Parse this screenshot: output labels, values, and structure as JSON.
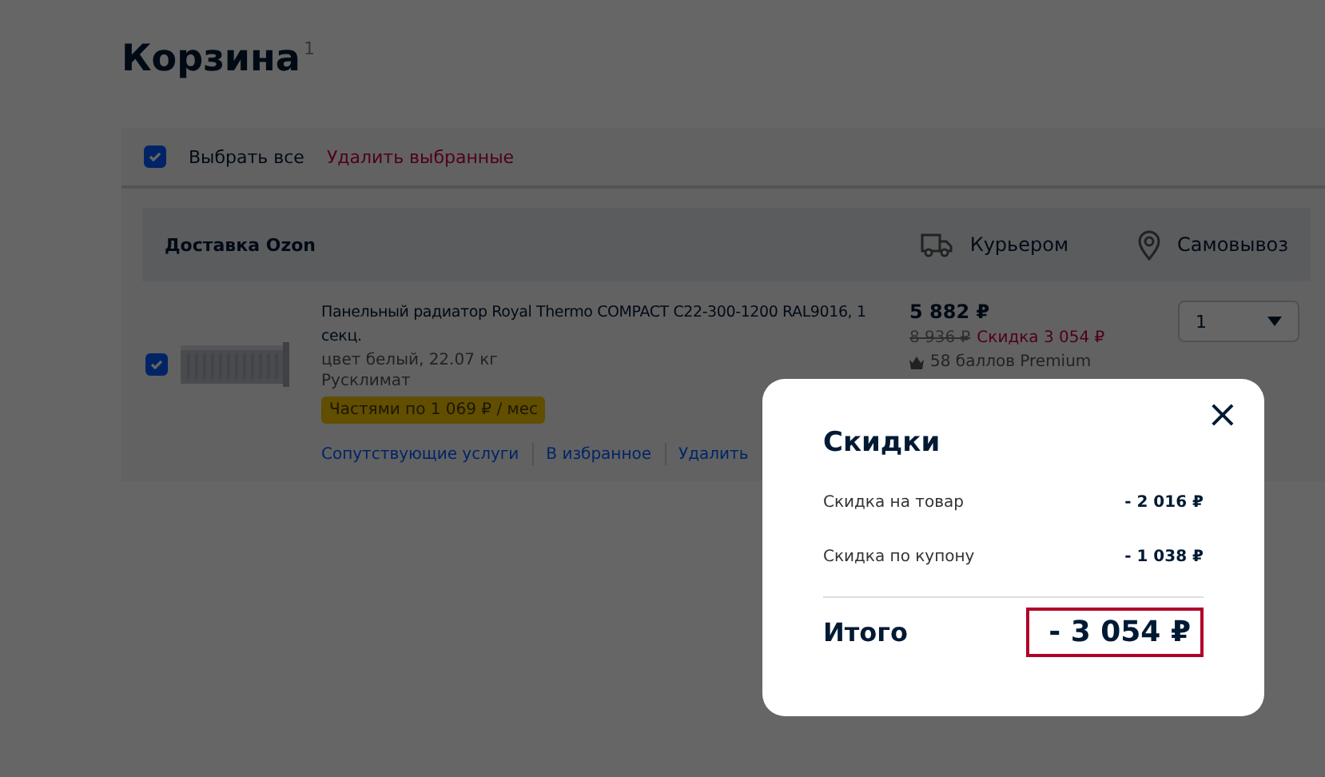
{
  "page_title": {
    "text": "Корзина",
    "count": "1"
  },
  "toolbar": {
    "select_all": {
      "label": "Выбрать все",
      "checked": true
    },
    "delete_selected": "Удалить выбранные"
  },
  "delivery": {
    "title": "Доставка Ozon",
    "options": [
      {
        "kind": "courier",
        "label": "Курьером"
      },
      {
        "kind": "pickup",
        "label": "Самовывоз"
      }
    ]
  },
  "items": [
    {
      "checked": true,
      "kind": "picture",
      "name": "Панельный радиатор Royal Thermo COMPACT C22-300-1200 RAL9016, 1 секц.",
      "details": "цвет белый, 22.07 кг",
      "seller": "Русклимат",
      "installment": "Частями по 1 069 ₽ / мес",
      "actions": [
        "Сопутствующие услуги",
        "В избранное",
        "Удалить"
      ],
      "price": "5 882 ₽",
      "old_price": "8 936 ₽",
      "discount": "Скидка 3 054 ₽",
      "bonus": "58 баллов Premium",
      "quantity": "1"
    }
  ],
  "modal": {
    "title": "Скидки",
    "close": "×",
    "rows": [
      {
        "label": "Скидка на товар",
        "value": "- 2 016 ₽"
      },
      {
        "label": "Скидка по купону",
        "value": "- 1 038 ₽"
      }
    ],
    "total": {
      "label": "Итого",
      "value": "- 3 054 ₽",
      "highlighted": true
    }
  }
}
